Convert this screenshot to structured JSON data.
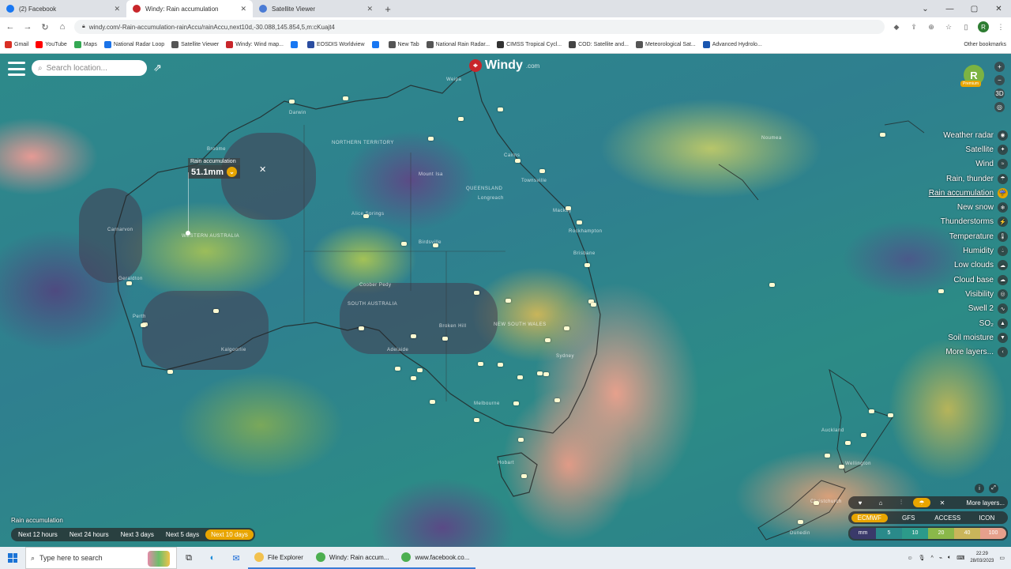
{
  "browser": {
    "tabs": [
      {
        "title": "(2) Facebook",
        "favicon_color": "#1877f2"
      },
      {
        "title": "Windy: Rain accumulation",
        "favicon_color": "#c8262b",
        "active": true
      },
      {
        "title": "Satellite Viewer",
        "favicon_color": "#4a7bd5"
      }
    ],
    "new_tab": "+",
    "url": "windy.com/-Rain-accumulation-rainAccu/rainAccu,next10d,-30.088,145.854,5,m:cKuajt4",
    "bookmarks": [
      {
        "label": "Gmail",
        "color": "#d93025"
      },
      {
        "label": "YouTube",
        "color": "#ff0000"
      },
      {
        "label": "Maps",
        "color": "#34a853"
      },
      {
        "label": "National Radar Loop",
        "color": "#1a73e8"
      },
      {
        "label": "Satellite Viewer",
        "color": "#555555"
      },
      {
        "label": "Windy: Wind map...",
        "color": "#c8262b"
      },
      {
        "label": "",
        "color": "#1877f2"
      },
      {
        "label": "EOSDIS Worldview",
        "color": "#2b4da0"
      },
      {
        "label": "",
        "color": "#1877f2"
      },
      {
        "label": "New Tab",
        "color": "#555555"
      },
      {
        "label": "National Rain Radar...",
        "color": "#555555"
      },
      {
        "label": "CIMSS Tropical Cycl...",
        "color": "#333333"
      },
      {
        "label": "COD: Satellite and...",
        "color": "#444444"
      },
      {
        "label": "Meteorological Sat...",
        "color": "#555555"
      },
      {
        "label": "Advanced Hydrolo...",
        "color": "#1a56b0"
      }
    ],
    "other_bookmarks": "Other bookmarks",
    "profile_initial": "R"
  },
  "windy": {
    "search_placeholder": "Search location...",
    "logo_text": "Windy",
    "logo_suffix": ".com",
    "user_initial": "R",
    "premium_badge": "Premium",
    "popup": {
      "label": "Rain accumulation",
      "value": "51.1mm"
    },
    "layers": [
      {
        "label": "Weather radar",
        "icon": "radar-icon"
      },
      {
        "label": "Satellite",
        "icon": "satellite-icon"
      },
      {
        "label": "Wind",
        "icon": "wind-icon"
      },
      {
        "label": "Rain, thunder",
        "icon": "rain-icon"
      },
      {
        "label": "Rain accumulation",
        "icon": "rain-accumulation-icon",
        "active": true
      },
      {
        "label": "New snow",
        "icon": "snow-icon"
      },
      {
        "label": "Thunderstorms",
        "icon": "thunderstorm-icon"
      },
      {
        "label": "Temperature",
        "icon": "thermometer-icon"
      },
      {
        "label": "Humidity",
        "icon": "humidity-icon"
      },
      {
        "label": "Low clouds",
        "icon": "cloud-icon"
      },
      {
        "label": "Cloud base",
        "icon": "cloud-base-icon"
      },
      {
        "label": "Visibility",
        "icon": "eye-icon"
      },
      {
        "label": "Swell 2",
        "icon": "swell-icon"
      },
      {
        "label": "SO₂",
        "icon": "so2-icon"
      },
      {
        "label": "Soil moisture",
        "icon": "soil-icon"
      },
      {
        "label": "More layers...",
        "icon": "chevron-left-icon"
      }
    ],
    "accumulation": {
      "label": "Rain accumulation",
      "options": [
        "Next 12 hours",
        "Next 24 hours",
        "Next 3 days",
        "Next 5 days",
        "Next 10 days"
      ],
      "selected": "Next 10 days"
    },
    "map_labels": [
      "NORTHERN TERRITORY",
      "QUEENSLAND",
      "WESTERN AUSTRALIA",
      "SOUTH AUSTRALIA",
      "NEW SOUTH WALES",
      "Darwin",
      "Broome",
      "Carnarvon",
      "Geraldton",
      "Kalgoorlie",
      "Alice Springs",
      "Mount Isa",
      "Longreach",
      "Birdsville",
      "Coober Pedy",
      "Broken Hill",
      "Brisbane",
      "Sydney",
      "Melbourne",
      "Adelaide",
      "Hobart",
      "Perth",
      "Rockhampton",
      "Mackay",
      "Townsville",
      "Cairns",
      "Weipa",
      "Noumea",
      "Auckland",
      "Wellington",
      "Christchurch",
      "Dunedin"
    ],
    "bottom_right": {
      "more_layers": "More layers...",
      "models": [
        "ECMWF",
        "GFS",
        "ACCESS",
        "ICON"
      ],
      "selected_model": "ECMWF",
      "legend": [
        {
          "label": "mm",
          "color": "#3a3a6a"
        },
        {
          "label": "5",
          "color": "#2a8a8a"
        },
        {
          "label": "10",
          "color": "#2c9a8a"
        },
        {
          "label": "20",
          "color": "#8ab84a"
        },
        {
          "label": "40",
          "color": "#c9b55a"
        },
        {
          "label": "100",
          "color": "#e6a08c"
        }
      ]
    }
  },
  "taskbar": {
    "search_placeholder": "Type here to search",
    "apps": [
      {
        "label": "File Explorer",
        "color": "#f2c14e"
      },
      {
        "label": "Windy: Rain accum...",
        "color": "#4caf50"
      },
      {
        "label": "www.facebook.co...",
        "color": "#4caf50"
      }
    ],
    "time": "22:29",
    "date": "28/03/2023"
  }
}
